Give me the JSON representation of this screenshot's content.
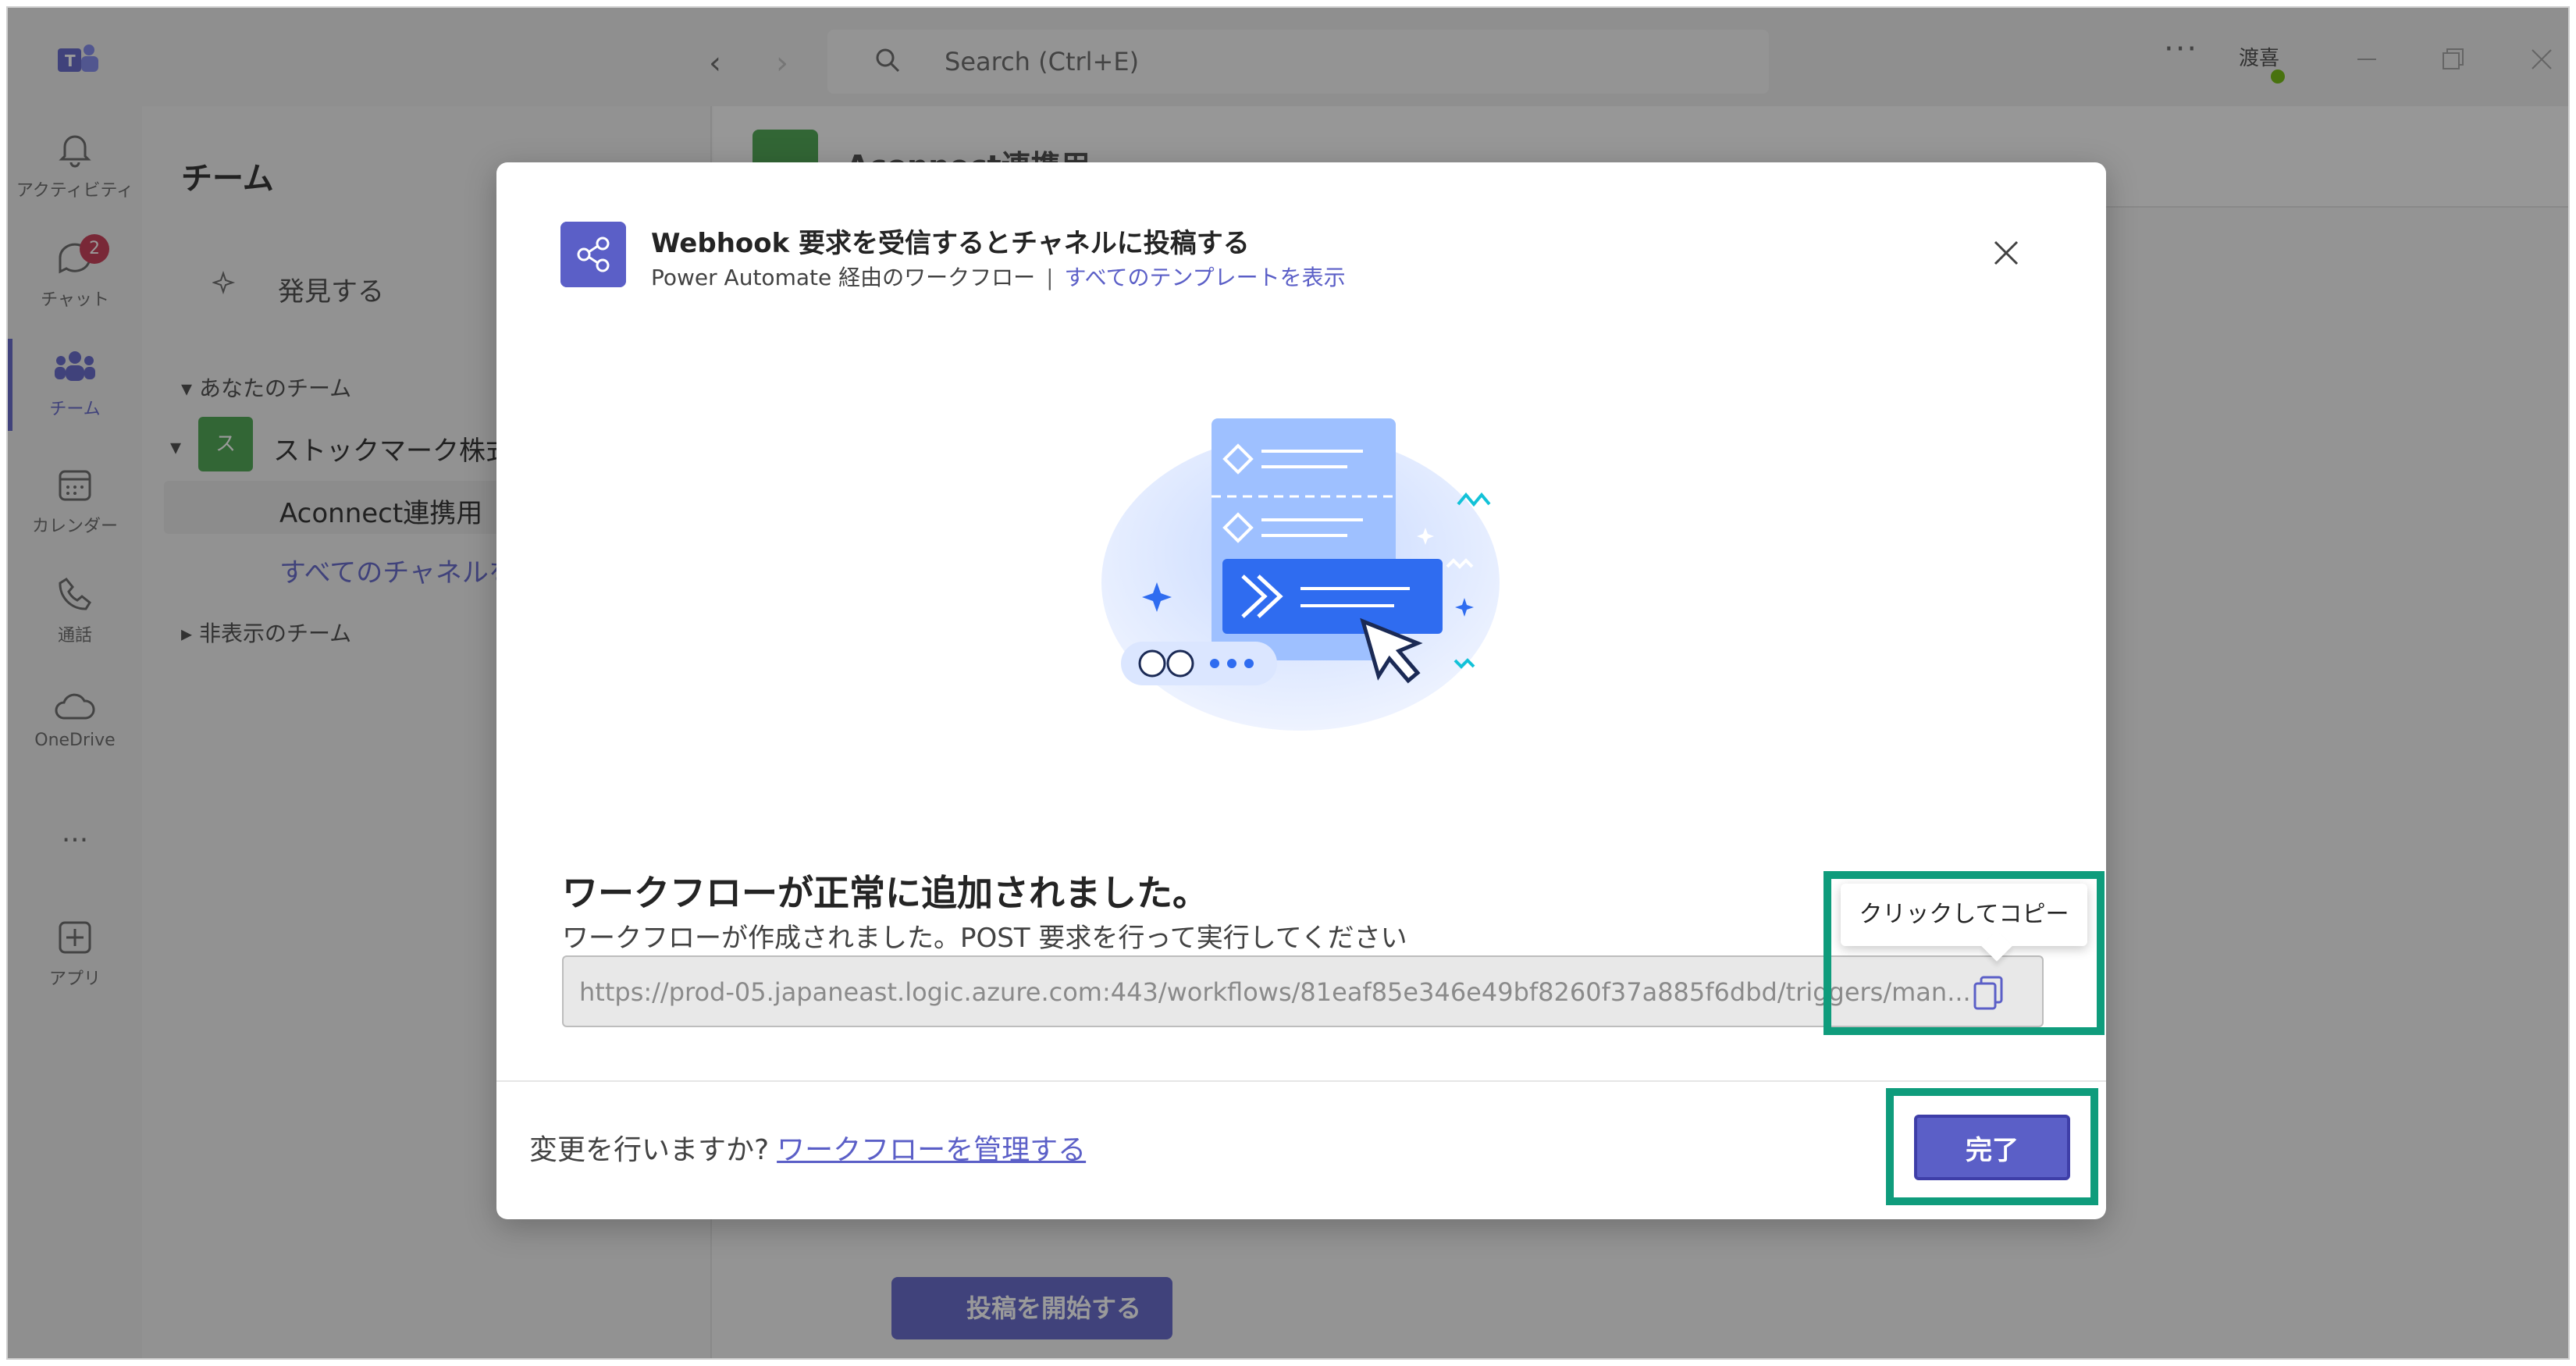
{
  "titlebar": {
    "search_placeholder": "Search (Ctrl+E)",
    "more": "···",
    "user_initials": "渡喜"
  },
  "rail": {
    "items": [
      {
        "label": "アクティビティ",
        "icon": "bell-icon"
      },
      {
        "label": "チャット",
        "icon": "chat-icon",
        "badge": "2"
      },
      {
        "label": "チーム",
        "icon": "teams-icon"
      },
      {
        "label": "カレンダー",
        "icon": "calendar-icon"
      },
      {
        "label": "通話",
        "icon": "phone-icon"
      },
      {
        "label": "OneDrive",
        "icon": "cloud-icon"
      },
      {
        "label": "···",
        "icon": "more-icon"
      },
      {
        "label": "アプリ",
        "icon": "add-app-icon"
      }
    ]
  },
  "team_panel": {
    "title": "チーム",
    "discover": "発見する",
    "your_teams": "あなたのチーム",
    "team_initial": "ス",
    "team_name": "ストックマーク株式会",
    "channel": "Aconnect連携用",
    "all_channels": "すべてのチャネルを表",
    "hidden": "非表示のチーム"
  },
  "main": {
    "channel_title": "Aconnect連携用",
    "start_post": "投稿を開始する"
  },
  "dialog": {
    "title": "Webhook 要求を受信するとチャネルに投稿する",
    "subtitle": "Power Automate 経由のワークフロー",
    "separator": "|",
    "templates_link": "すべてのテンプレートを表示",
    "success_title": "ワークフローが正常に追加されました。",
    "success_desc": "ワークフローが作成されました。POST 要求を行って実行してください",
    "url": "https://prod-05.japaneast.logic.azure.com:443/workflows/81eaf85e346e49bf8260f37a885f6dbd/triggers/man...",
    "tooltip": "クリックしてコピー",
    "footer_question": "変更を行いますか?",
    "manage_link": "ワークフローを管理する",
    "done_label": "完了"
  },
  "colors": {
    "accent": "#5b5fc7",
    "highlight": "#0f9c7c",
    "badge": "#c4314b",
    "team_green": "#43a047"
  }
}
